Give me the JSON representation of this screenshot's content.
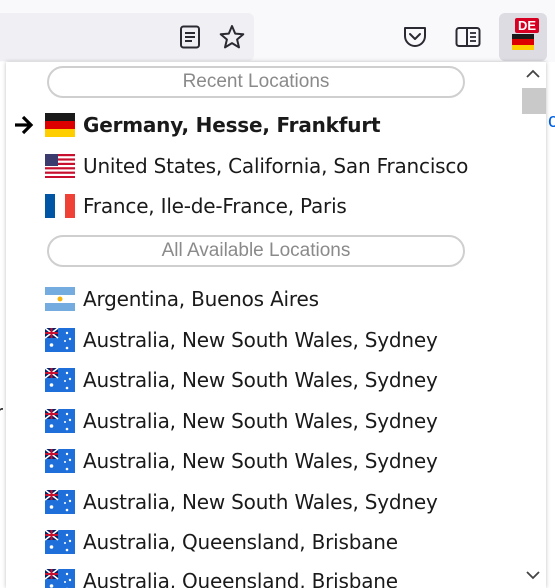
{
  "extension": {
    "badge": "DE",
    "flag_icon": "germany-flag-icon"
  },
  "toolbar": {
    "reader_icon": "reader-view-icon",
    "bookmark_icon": "bookmark-star-icon",
    "pocket_icon": "pocket-icon",
    "sidebar_icon": "sidebar-icon"
  },
  "background_fragments": {
    "right_char": "c",
    "left_char": "r"
  },
  "popup": {
    "recent_header": "Recent Locations",
    "all_header": "All Available Locations",
    "recent": [
      {
        "label": "Germany, Hesse, Frankfurt",
        "flag": "de",
        "current": true
      },
      {
        "label": "United States, California, San Francisco",
        "flag": "us",
        "current": false
      },
      {
        "label": "France, Ile-de-France, Paris",
        "flag": "fr",
        "current": false
      }
    ],
    "all": [
      {
        "label": "Argentina, Buenos Aires",
        "flag": "ar"
      },
      {
        "label": "Australia, New South Wales, Sydney",
        "flag": "au"
      },
      {
        "label": "Australia, New South Wales, Sydney",
        "flag": "au"
      },
      {
        "label": "Australia, New South Wales, Sydney",
        "flag": "au"
      },
      {
        "label": "Australia, New South Wales, Sydney",
        "flag": "au"
      },
      {
        "label": "Australia, New South Wales, Sydney",
        "flag": "au"
      },
      {
        "label": "Australia, Queensland, Brisbane",
        "flag": "au"
      },
      {
        "label": "Australia, Queensland, Brisbane",
        "flag": "au"
      }
    ]
  },
  "colors": {
    "accent_blue": "#0060df",
    "badge_red": "#d70022",
    "header_border": "#cfcfcf",
    "header_text": "#8a8a8a"
  }
}
